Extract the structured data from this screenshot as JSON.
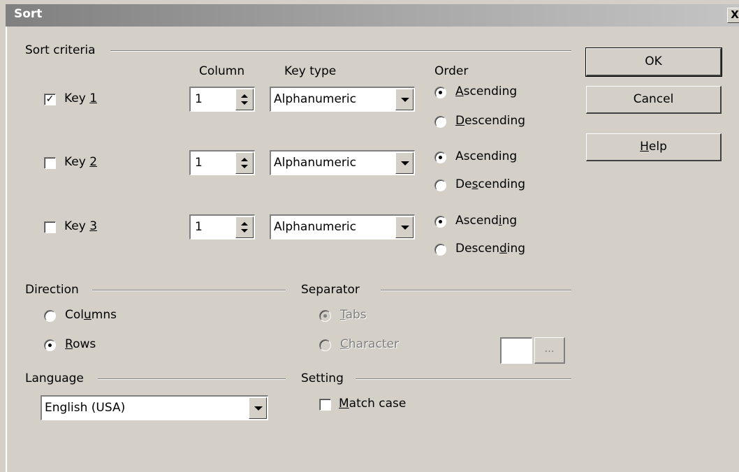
{
  "window": {
    "title": "Sort",
    "close_label": "X"
  },
  "sort_criteria": {
    "legend": "Sort criteria",
    "headers": {
      "column": "Column",
      "key_type": "Key type",
      "order": "Order"
    },
    "keys": [
      {
        "pre": "Key ",
        "mn": "1",
        "checked": true,
        "column": "1",
        "key_type": "Alphanumeric",
        "asc": {
          "pre": "",
          "mn": "A",
          "post": "scending"
        },
        "desc": {
          "pre": "",
          "mn": "D",
          "post": "escending"
        },
        "selected": "ascending"
      },
      {
        "pre": "Key ",
        "mn": "2",
        "checked": false,
        "column": "1",
        "key_type": "Alphanumeric",
        "asc": {
          "pre": "Ascendin",
          "mn": "g",
          "post": ""
        },
        "desc": {
          "pre": "De",
          "mn": "s",
          "post": "cending"
        },
        "selected": "ascending"
      },
      {
        "pre": "Key ",
        "mn": "3",
        "checked": false,
        "column": "1",
        "key_type": "Alphanumeric",
        "asc": {
          "pre": "Ascend",
          "mn": "i",
          "post": "ng"
        },
        "desc": {
          "pre": "Descen",
          "mn": "d",
          "post": "ing"
        },
        "selected": "ascending"
      }
    ]
  },
  "direction": {
    "legend": "Direction",
    "columns": {
      "pre": "Col",
      "mn": "u",
      "post": "mns"
    },
    "rows": {
      "pre": "",
      "mn": "R",
      "post": "ows"
    },
    "selected": "rows"
  },
  "separator": {
    "legend": "Separator",
    "tabs": {
      "pre": "",
      "mn": "T",
      "post": "abs"
    },
    "character": {
      "pre": "",
      "mn": "C",
      "post": "haracter"
    },
    "selected": "tabs",
    "enabled": false,
    "browse_label": "..."
  },
  "language": {
    "legend": "Language",
    "value": "English (USA)"
  },
  "setting": {
    "legend": "Setting",
    "match_case": {
      "pre": "",
      "mn": "M",
      "post": "atch case"
    },
    "match_case_checked": false
  },
  "buttons": {
    "ok": "OK",
    "cancel": "Cancel",
    "help": {
      "pre": "",
      "mn": "H",
      "post": "elp"
    }
  }
}
